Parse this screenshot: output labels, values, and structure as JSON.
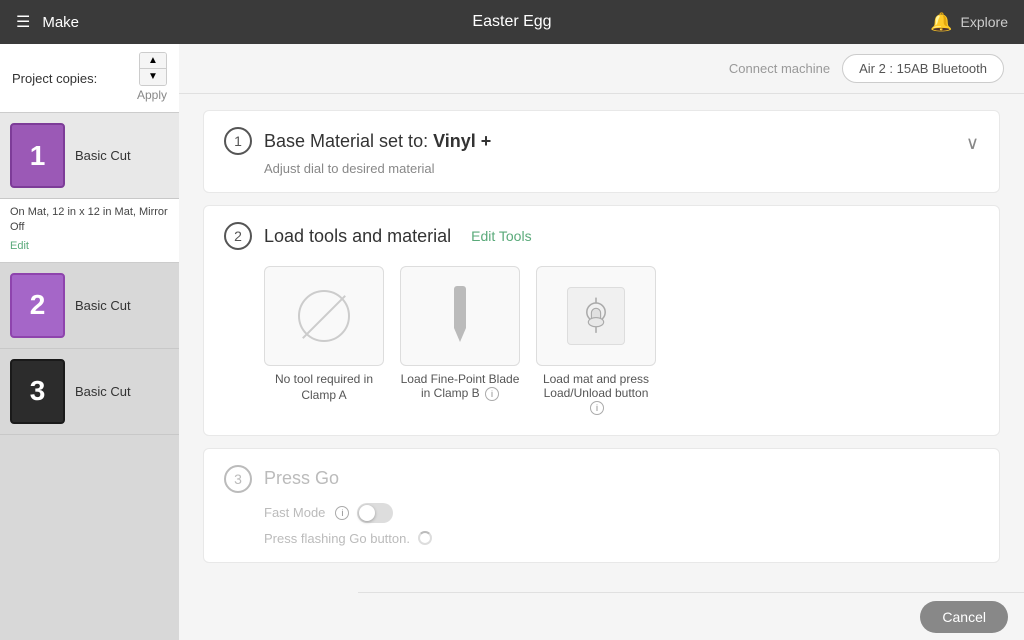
{
  "header": {
    "menu_icon": "☰",
    "app_name": "Make",
    "title": "Easter Egg",
    "bell_icon": "🔔",
    "explore_label": "Explore"
  },
  "connect_bar": {
    "connect_label": "Connect machine",
    "machine_btn": "Air 2 : 15AB Bluetooth"
  },
  "sidebar": {
    "project_copies_label": "Project copies:",
    "apply_label": "Apply",
    "items": [
      {
        "number": "1",
        "color": "purple",
        "label": "Basic Cut"
      },
      {
        "number": "2",
        "color": "purple2",
        "label": "Basic Cut"
      },
      {
        "number": "3",
        "color": "black",
        "label": "Basic Cut"
      }
    ],
    "item_info": {
      "description": "On Mat, 12 in x 12 in Mat, Mirror Off",
      "edit_label": "Edit"
    }
  },
  "steps": {
    "step1": {
      "number": "1",
      "title": "Base Material set to:",
      "material": "Vinyl +",
      "subtitle": "Adjust dial to desired material"
    },
    "step2": {
      "number": "2",
      "title": "Load tools and material",
      "edit_tools_label": "Edit Tools",
      "tools": [
        {
          "label": "No tool required in Clamp A"
        },
        {
          "label": "Load Fine-Point Blade in Clamp B",
          "has_info": true
        },
        {
          "label": "Load mat and press Load/Unload button",
          "has_info": true
        }
      ]
    },
    "step3": {
      "number": "3",
      "title": "Press Go",
      "fast_mode_label": "Fast Mode",
      "press_go_label": "Press flashing Go button."
    }
  },
  "bottom_bar": {
    "cancel_label": "Cancel"
  }
}
